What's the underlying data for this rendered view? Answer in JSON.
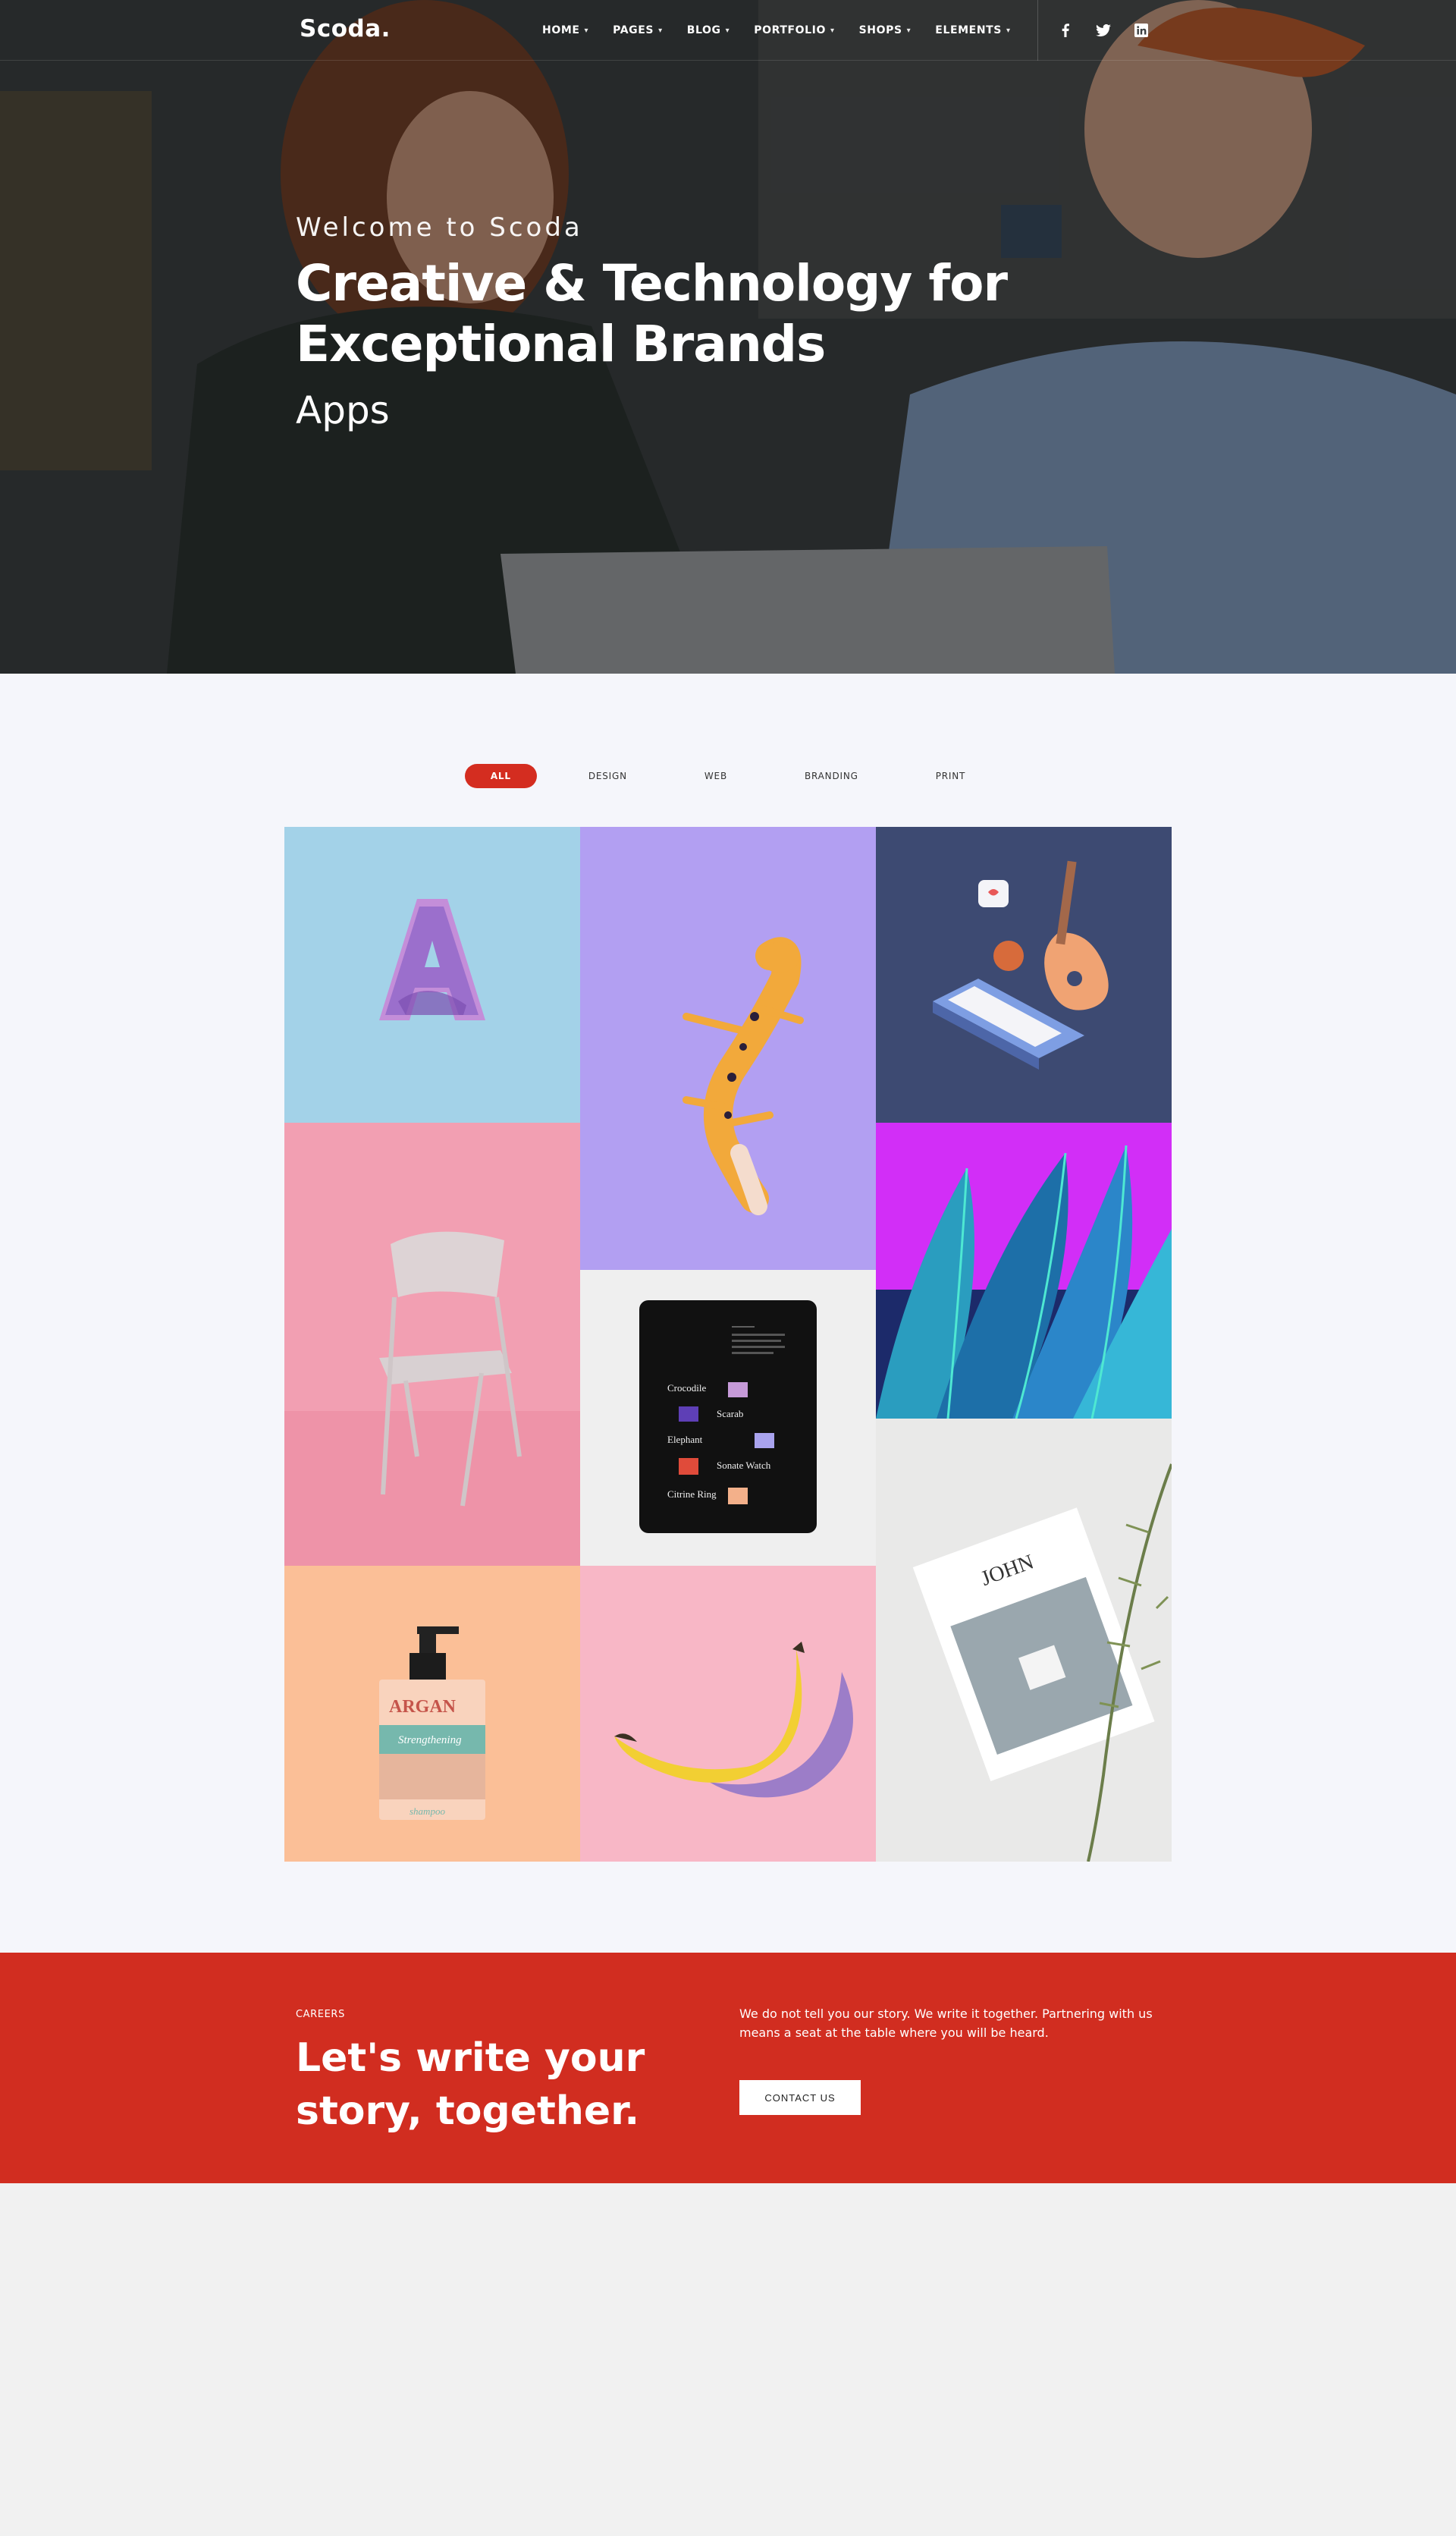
{
  "brand": {
    "logo": "Scoda."
  },
  "nav": {
    "items": [
      {
        "label": "HOME"
      },
      {
        "label": "PAGES"
      },
      {
        "label": "BLOG"
      },
      {
        "label": "PORTFOLIO"
      },
      {
        "label": "SHOPS"
      },
      {
        "label": "ELEMENTS"
      }
    ],
    "social": [
      "facebook-icon",
      "twitter-icon",
      "linkedin-icon"
    ]
  },
  "hero": {
    "welcome": "Welcome to Scoda",
    "headline": "Creative & Technology for Exceptional Brands",
    "rotating_word": "Apps"
  },
  "portfolio": {
    "filters": [
      {
        "label": "ALL",
        "active": true
      },
      {
        "label": "DESIGN"
      },
      {
        "label": "WEB"
      },
      {
        "label": "BRANDING"
      },
      {
        "label": "PRINT"
      }
    ],
    "menu_card": {
      "items": [
        "Crocodile",
        "Scarab",
        "Elephant",
        "Sonate Watch",
        "Citrine Ring"
      ]
    },
    "product_label": {
      "brand": "ARGAN",
      "line": "Strengthening",
      "type": "shampoo"
    },
    "magazine_title": "JOHN"
  },
  "careers": {
    "tag": "CAREERS",
    "title": "Let's write your story, together.",
    "description": "We do not tell you our story. We write it together. Partnering with us means a seat at the table where you will be heard.",
    "button": "CONTACT US"
  },
  "colors": {
    "accent": "#d42d20",
    "careers_bg": "#d12d20",
    "portfolio_bg": "#f5f6fb"
  }
}
